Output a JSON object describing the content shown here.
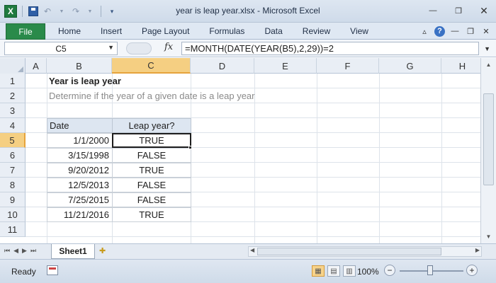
{
  "window": {
    "title": "year is leap year.xlsx  -  Microsoft Excel"
  },
  "qat": {
    "app_icon": "X"
  },
  "ribbon": {
    "file_label": "File",
    "tabs": [
      "Home",
      "Insert",
      "Page Layout",
      "Formulas",
      "Data",
      "Review",
      "View"
    ]
  },
  "formula_bar": {
    "name_box": "C5",
    "fx": "fx",
    "formula": "=MONTH(DATE(YEAR(B5),2,29))=2"
  },
  "grid": {
    "columns": [
      "A",
      "B",
      "C",
      "D",
      "E",
      "F",
      "G",
      "H"
    ],
    "active_column": "C",
    "rows": [
      "1",
      "2",
      "3",
      "4",
      "5",
      "6",
      "7",
      "8",
      "9",
      "10",
      "11"
    ],
    "active_row": "5",
    "title": "Year is leap year",
    "subtitle": "Determine if the year of a given date is a leap year",
    "table": {
      "headers": [
        "Date",
        "Leap year?"
      ],
      "rows": [
        [
          "1/1/2000",
          "TRUE"
        ],
        [
          "3/15/1998",
          "FALSE"
        ],
        [
          "9/20/2012",
          "TRUE"
        ],
        [
          "12/5/2013",
          "FALSE"
        ],
        [
          "7/25/2015",
          "FALSE"
        ],
        [
          "11/21/2016",
          "TRUE"
        ]
      ]
    }
  },
  "sheets": {
    "active": "Sheet1"
  },
  "status": {
    "ready": "Ready",
    "zoom": "100%",
    "zoom_level": 1.0
  },
  "colors": {
    "file_tab": "#2a8a4a",
    "active_header": "#f5cf82",
    "table_header": "#dde6f1"
  }
}
